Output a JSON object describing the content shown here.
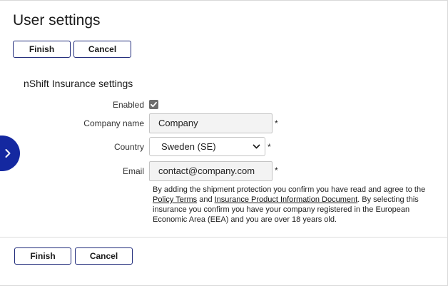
{
  "page": {
    "title": "User settings"
  },
  "toolbar": {
    "finish_label": "Finish",
    "cancel_label": "Cancel"
  },
  "section": {
    "title": "nShift Insurance settings",
    "fields": {
      "enabled": {
        "label": "Enabled",
        "checked": true
      },
      "company": {
        "label": "Company name",
        "value": "Company",
        "required": "*"
      },
      "country": {
        "label": "Country",
        "value": "Sweden (SE)",
        "required": "*"
      },
      "email": {
        "label": "Email",
        "value": "contact@company.com",
        "required": "*"
      }
    },
    "disclaimer": {
      "text_1": "By adding the shipment protection you confirm you have read and agree to the ",
      "link_policy": "Policy Terms",
      "text_2": " and ",
      "link_ipid": "Insurance Product Information Document",
      "text_3": ". By selecting this insurance you confirm you have your company registered in the European Economic Area (EEA) and you are over 18 years old."
    }
  },
  "footer": {
    "finish_label": "Finish",
    "cancel_label": "Cancel"
  },
  "icons": {
    "side_tab": "chevron-right-icon",
    "select": "chevron-down-icon",
    "checkbox": "check-icon"
  },
  "colors": {
    "accent": "#1428a0",
    "button_border": "#1f2a7a"
  }
}
